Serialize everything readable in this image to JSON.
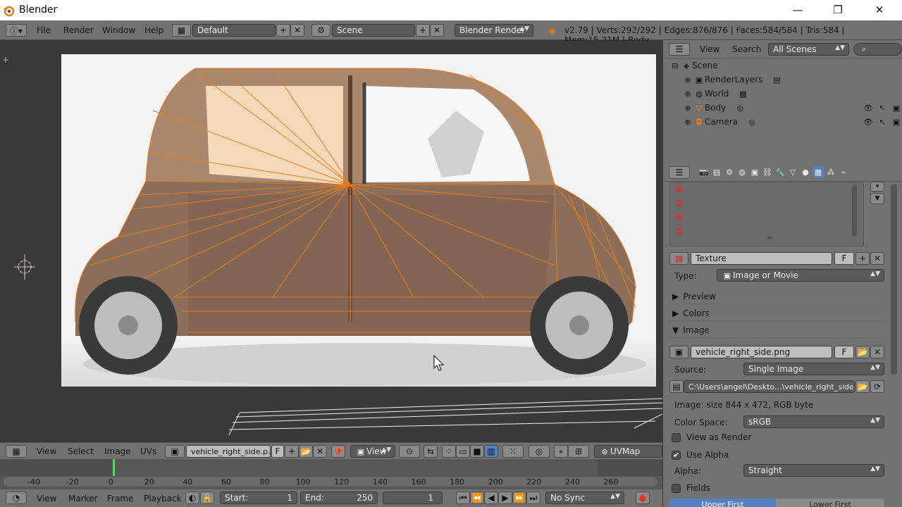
{
  "window": {
    "title": "Blender",
    "minimize": "—",
    "maximize": "❐",
    "close": "✕"
  },
  "top_menu": {
    "items": [
      "File",
      "Render",
      "Window",
      "Help"
    ],
    "screen_layout": "Default",
    "scene": "Scene",
    "render_engine": "Blender Render",
    "stats": "v2.79 | Verts:292/292 | Edges:876/876 | Faces:584/584 | Tris:584 | Mem:15.21M | Body"
  },
  "outliner": {
    "menu": [
      "View",
      "Search"
    ],
    "display_mode": "All Scenes",
    "tree": [
      {
        "label": "Scene"
      },
      {
        "label": "RenderLayers"
      },
      {
        "label": "World"
      },
      {
        "label": "Body"
      },
      {
        "label": "Camera"
      }
    ]
  },
  "properties": {
    "texture_name": "Texture",
    "texture_flag": "F",
    "type_label": "Type:",
    "type_value": "Image or Movie",
    "sections": {
      "preview": "Preview",
      "colors": "Colors",
      "image": "Image"
    },
    "image_name": "vehicle_right_side.png",
    "image_flag": "F",
    "source_label": "Source:",
    "source_value": "Single Image",
    "filepath": "C:\\Users\\angel\\Deskto...\\vehicle_right_side.png",
    "image_info": "Image: size 844 x 472, RGB byte",
    "color_space_label": "Color Space:",
    "color_space_value": "sRGB",
    "view_as_render": "View as Render",
    "use_alpha": "Use Alpha",
    "alpha_label": "Alpha:",
    "alpha_value": "Straight",
    "fields": "Fields",
    "upper_first": "Upper First",
    "lower_first": "Lower First"
  },
  "uv_header": {
    "menu": [
      "View",
      "Select",
      "Image",
      "UVs"
    ],
    "image_name": "vehicle_right_side.p...",
    "image_flag": "F",
    "view_dropdown": "View",
    "uv_map": "UVMap"
  },
  "timeline": {
    "ticks": [
      "-40",
      "-20",
      "0",
      "20",
      "40",
      "60",
      "80",
      "100",
      "120",
      "140",
      "160",
      "180",
      "200",
      "220",
      "240",
      "260"
    ],
    "current_frame": 0
  },
  "timeline_header": {
    "menu": [
      "View",
      "Marker",
      "Frame",
      "Playback"
    ],
    "start_label": "Start:",
    "start_value": "1",
    "end_label": "End:",
    "end_value": "250",
    "current": "1",
    "sync": "No Sync"
  },
  "colors": {
    "accent": "#f07b18",
    "header": "#727272",
    "viewport": "#393939",
    "highlight": "#5680c2"
  }
}
